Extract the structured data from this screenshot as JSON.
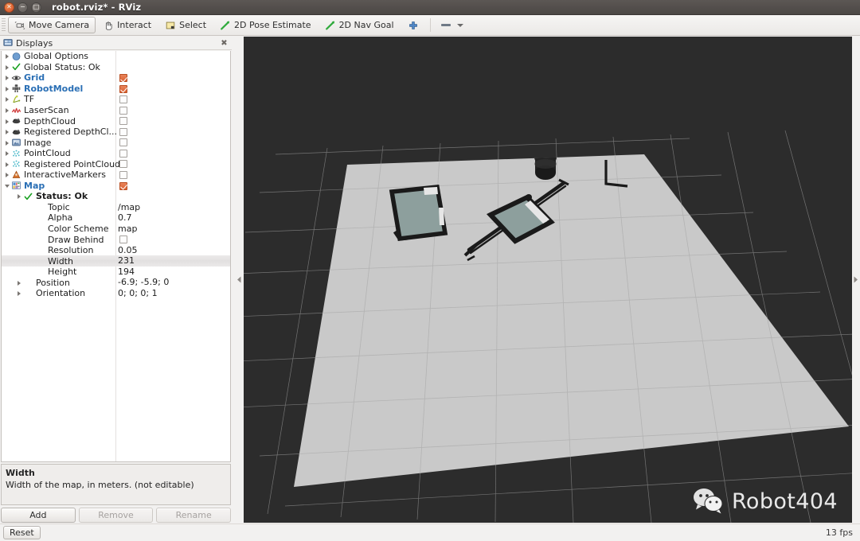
{
  "window": {
    "title": "robot.rviz* - RViz",
    "close_icon": "window-close-icon",
    "minimize_icon": "window-minimize-icon",
    "maximize_icon": "window-maximize-icon"
  },
  "toolbar": {
    "items": [
      {
        "label": "Move Camera",
        "icon": "move-camera-icon",
        "active": true
      },
      {
        "label": "Interact",
        "icon": "interact-hand-icon",
        "active": false
      },
      {
        "label": "Select",
        "icon": "select-rect-icon",
        "active": false
      },
      {
        "label": "2D Pose Estimate",
        "icon": "pose-estimate-arrow-icon",
        "active": false
      },
      {
        "label": "2D Nav Goal",
        "icon": "nav-goal-arrow-icon",
        "active": false
      }
    ],
    "plus_icon": "plus-icon",
    "measure_icon": "measure-icon",
    "overflow_icon": "chevron-down-icon"
  },
  "displays_panel": {
    "title": "Displays",
    "title_icon": "displays-panel-icon",
    "close_icon": "close-icon",
    "rows": [
      {
        "label": "Global Options",
        "icon": "globe-icon",
        "indent": 0,
        "twisty": "closed",
        "style": "plain",
        "check": null
      },
      {
        "label": "Global Status: Ok",
        "icon": "status-ok-check-icon",
        "indent": 0,
        "twisty": "closed",
        "style": "plain",
        "check": null
      },
      {
        "label": "Grid",
        "icon": "grid-eye-icon",
        "indent": 0,
        "twisty": "closed",
        "style": "hl",
        "check": true
      },
      {
        "label": "RobotModel",
        "icon": "robot-model-icon",
        "indent": 0,
        "twisty": "closed",
        "style": "hl",
        "check": true
      },
      {
        "label": "TF",
        "icon": "tf-axes-icon",
        "indent": 0,
        "twisty": "closed",
        "style": "plain",
        "check": false
      },
      {
        "label": "LaserScan",
        "icon": "laser-scan-icon",
        "indent": 0,
        "twisty": "closed",
        "style": "plain",
        "check": false
      },
      {
        "label": "DepthCloud",
        "icon": "depth-cloud-icon",
        "indent": 0,
        "twisty": "closed",
        "style": "plain",
        "check": false
      },
      {
        "label": "Registered DepthCl...",
        "icon": "depth-cloud-icon",
        "indent": 0,
        "twisty": "closed",
        "style": "plain",
        "check": false
      },
      {
        "label": "Image",
        "icon": "image-icon",
        "indent": 0,
        "twisty": "closed",
        "style": "plain",
        "check": false
      },
      {
        "label": "PointCloud",
        "icon": "point-cloud-icon",
        "indent": 0,
        "twisty": "closed",
        "style": "plain",
        "check": false
      },
      {
        "label": "Registered PointCloud",
        "icon": "point-cloud-icon",
        "indent": 0,
        "twisty": "closed",
        "style": "plain",
        "check": false
      },
      {
        "label": "InteractiveMarkers",
        "icon": "interactive-markers-icon",
        "indent": 0,
        "twisty": "closed",
        "style": "plain",
        "check": false
      },
      {
        "label": "Map",
        "icon": "map-icon",
        "indent": 0,
        "twisty": "open",
        "style": "hl",
        "check": true
      },
      {
        "label": "Status: Ok",
        "icon": "status-ok-check-icon",
        "indent": 1,
        "twisty": "closed",
        "style": "bold",
        "check": null
      },
      {
        "label": "Topic",
        "indent": 2,
        "twisty": "none",
        "style": "plain",
        "value": "/map"
      },
      {
        "label": "Alpha",
        "indent": 2,
        "twisty": "none",
        "style": "plain",
        "value": "0.7"
      },
      {
        "label": "Color Scheme",
        "indent": 2,
        "twisty": "none",
        "style": "plain",
        "value": "map"
      },
      {
        "label": "Draw Behind",
        "indent": 2,
        "twisty": "none",
        "style": "plain",
        "check": false
      },
      {
        "label": "Resolution",
        "indent": 2,
        "twisty": "none",
        "style": "plain",
        "value": "0.05"
      },
      {
        "label": "Width",
        "indent": 2,
        "twisty": "none",
        "style": "plain",
        "value": "231",
        "selected": true
      },
      {
        "label": "Height",
        "indent": 2,
        "twisty": "none",
        "style": "plain",
        "value": "194"
      },
      {
        "label": "Position",
        "indent": 1,
        "twisty": "closed",
        "style": "plain",
        "value": "-6.9; -5.9; 0"
      },
      {
        "label": "Orientation",
        "indent": 1,
        "twisty": "closed",
        "style": "plain",
        "value": "0; 0; 0; 1"
      }
    ],
    "help": {
      "title": "Width",
      "text": "Width of the map, in meters. (not editable)"
    },
    "buttons": [
      {
        "label": "Add",
        "enabled": true
      },
      {
        "label": "Remove",
        "enabled": false
      },
      {
        "label": "Rename",
        "enabled": false
      }
    ]
  },
  "viewport": {
    "background_color": "#2c2c2c",
    "map_free_color": "#c9c9c9",
    "map_occupied_color": "#1a1a1a",
    "map_region_color": "#8a9e9c",
    "grid_line_color": "#9a9a9a",
    "watermark_text": "Robot404",
    "watermark_icon": "wechat-icon",
    "splitter_left_icon": "splitter-left-arrow-icon",
    "splitter_right_icon": "splitter-right-arrow-icon"
  },
  "statusbar": {
    "reset_label": "Reset",
    "fps": "13 fps"
  }
}
